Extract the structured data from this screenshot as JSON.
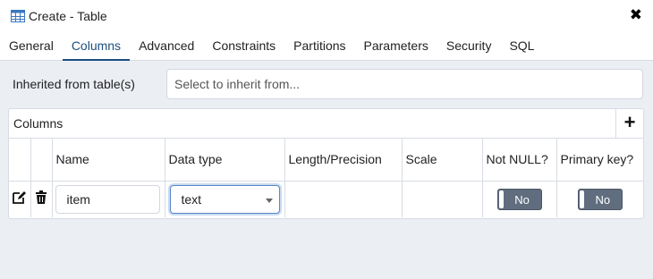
{
  "window": {
    "title": "Create - Table",
    "close_glyph": "✖"
  },
  "tabs": [
    {
      "label": "General"
    },
    {
      "label": "Columns"
    },
    {
      "label": "Advanced"
    },
    {
      "label": "Constraints"
    },
    {
      "label": "Partitions"
    },
    {
      "label": "Parameters"
    },
    {
      "label": "Security"
    },
    {
      "label": "SQL"
    }
  ],
  "active_tab": "Columns",
  "inherit": {
    "label": "Inherited from table(s)",
    "placeholder": "Select to inherit from..."
  },
  "grid": {
    "title": "Columns",
    "add_glyph": "+",
    "headers": [
      "Name",
      "Data type",
      "Length/Precision",
      "Scale",
      "Not NULL?",
      "Primary key?"
    ],
    "rows": [
      {
        "name": "item",
        "data_type": "text",
        "length": "",
        "scale": "",
        "not_null": "No",
        "primary_key": "No"
      }
    ]
  },
  "colors": {
    "accent": "#1c4e80",
    "toggle_bg": "#5f6d7e",
    "background": "#ebeef3"
  },
  "icons": [
    "table-icon",
    "close-icon",
    "add-icon",
    "edit-icon",
    "trash-icon",
    "caret-down-icon"
  ]
}
